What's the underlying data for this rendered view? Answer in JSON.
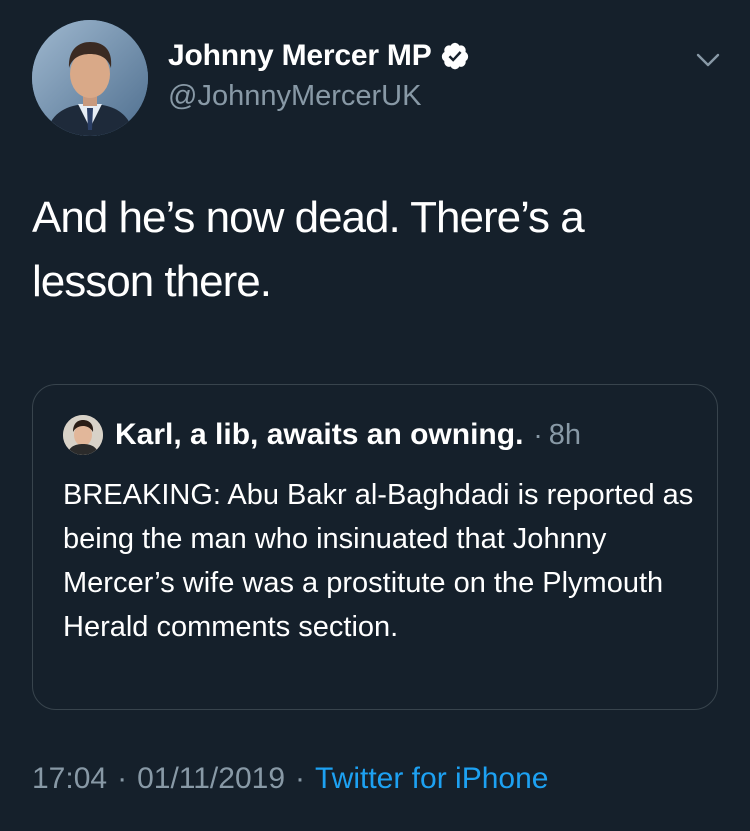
{
  "author": {
    "display_name": "Johnny Mercer MP",
    "handle": "@JohnnyMercerUK",
    "verified": true
  },
  "tweet": {
    "text": "And he’s now dead. There’s a lesson there."
  },
  "quoted_tweet": {
    "author_name": "Karl, a lib, awaits an owning.",
    "separator": "·",
    "time": "8h",
    "text": "BREAKING: Abu Bakr al-Baghdadi is reported as being the man who insinuated that Johnny Mercer’s wife was a prostitute on the Plymouth Herald comments section."
  },
  "meta": {
    "time": "17:04",
    "separator": "·",
    "date": "01/11/2019",
    "source": "Twitter for iPhone"
  },
  "colors": {
    "background": "#15202b",
    "muted": "#8899a6",
    "accent": "#1da1f2",
    "border": "#38444d"
  },
  "icons": {
    "verified": "verified-badge-icon",
    "menu": "chevron-down-icon"
  }
}
